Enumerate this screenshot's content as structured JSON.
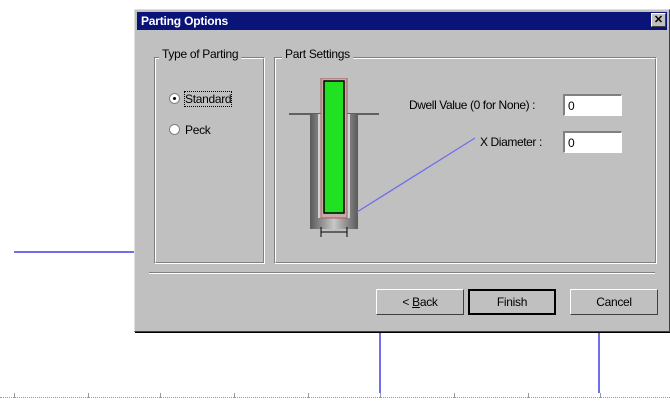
{
  "dialog": {
    "title": "Parting Options",
    "close_glyph": "✕"
  },
  "type_of_parting": {
    "legend": "Type of Parting",
    "options": [
      {
        "label": "Standard",
        "checked": true
      },
      {
        "label": "Peck",
        "checked": false
      }
    ]
  },
  "part_settings": {
    "legend": "Part Settings",
    "dwell": {
      "label": "Dwell Value (0 for None) :",
      "value": "0"
    },
    "x_diameter": {
      "label": "X Diameter :",
      "value": "0"
    }
  },
  "buttons": {
    "back": "< Back",
    "back_accesskey": "B",
    "finish": "Finish",
    "cancel": "Cancel"
  },
  "colors": {
    "titlebar": "#0a1478",
    "tool_green": "#22e022",
    "leader_line": "#6f6fe8"
  }
}
